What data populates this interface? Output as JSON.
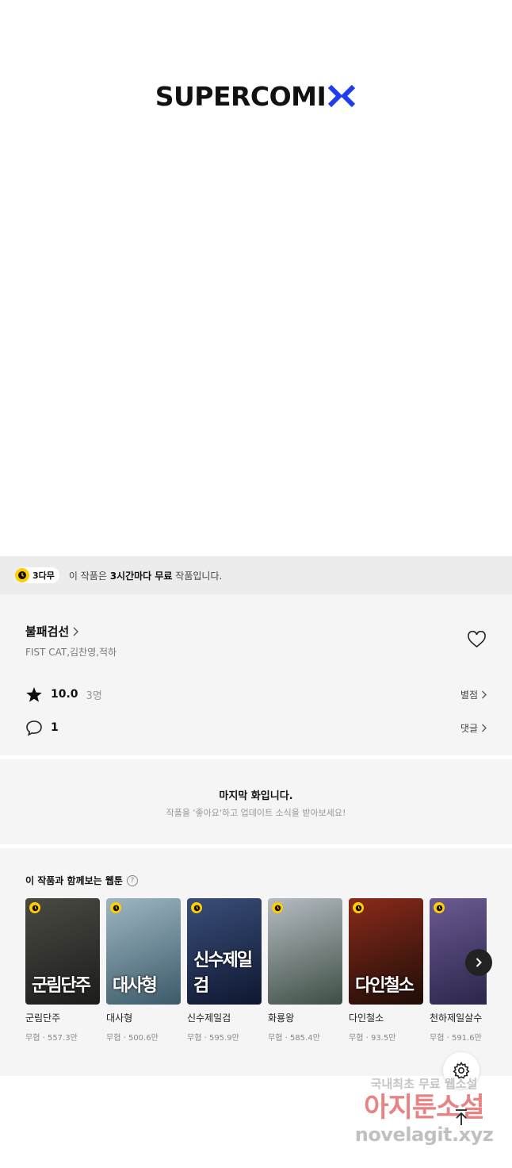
{
  "logo": {
    "text": "SUPERCOMI",
    "accent": "#1f3cf0"
  },
  "banner": {
    "badge": "3다무",
    "text_prefix": "이 작품은 ",
    "text_bold": "3시간마다 무료",
    "text_suffix": " 작품입니다."
  },
  "work": {
    "title": "불패검선",
    "authors": "FIST CAT,김찬영,적하",
    "rating": "10.0",
    "rating_count": "3명",
    "rating_link": "별점",
    "comment_count": "1",
    "comment_link": "댓글"
  },
  "last_episode": {
    "title": "마지막 화입니다.",
    "subtitle": "작품을 '좋아요'하고 업데이트 소식을 받아보세요!"
  },
  "recommend": {
    "heading": "이 작품과 함께보는 웹툰",
    "help": "?",
    "items": [
      {
        "title": "군림단주",
        "genre": "무협",
        "views": "557.3만",
        "art": "군림단주",
        "color1": "#4a4a44",
        "color2": "#1c1c1a"
      },
      {
        "title": "대사형",
        "genre": "무협",
        "views": "500.6만",
        "art": "대사형",
        "color1": "#9eb6c2",
        "color2": "#3c5a6a"
      },
      {
        "title": "신수제일검",
        "genre": "무협",
        "views": "595.9만",
        "art": "신수제일검",
        "color1": "#3a4e7a",
        "color2": "#0e1730"
      },
      {
        "title": "화룡왕",
        "genre": "무협",
        "views": "585.4만",
        "art": "",
        "color1": "#b5bcc3",
        "color2": "#3e4e44"
      },
      {
        "title": "다인철소",
        "genre": "무협",
        "views": "93.5만",
        "art": "다인철소",
        "color1": "#8a2a1a",
        "color2": "#1e0d08"
      },
      {
        "title": "천하제일살수",
        "genre": "무협",
        "views": "591.6만",
        "art": "",
        "color1": "#6a5a92",
        "color2": "#2a2248"
      }
    ]
  },
  "watermark": {
    "line1": "국내최초 무료 웹소설",
    "line2": "아지툰소설",
    "line3": "novelagit.xyz"
  }
}
